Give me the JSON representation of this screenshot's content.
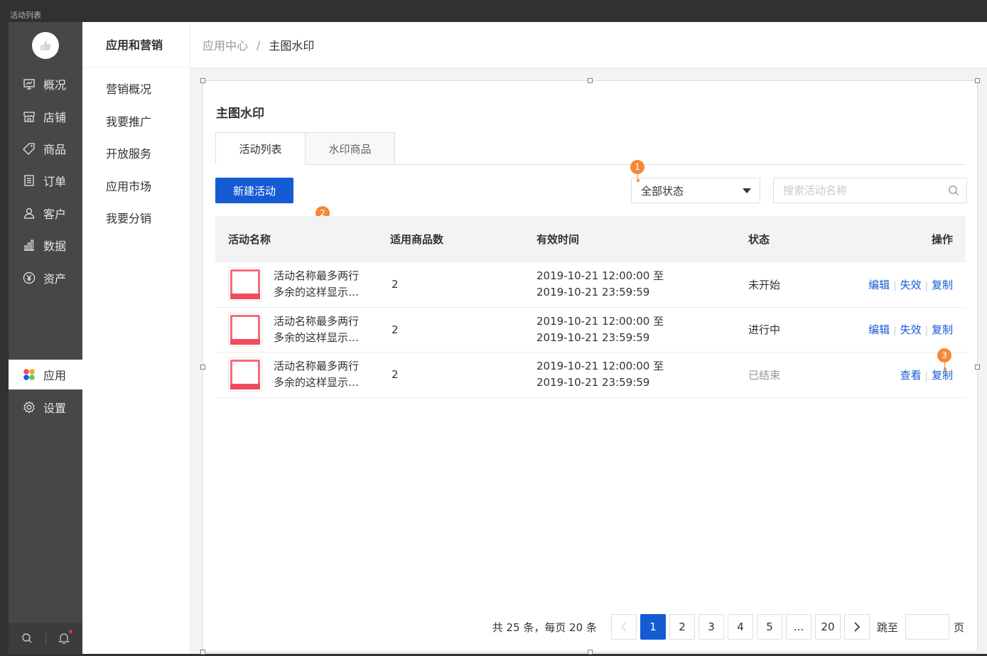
{
  "window": {
    "title": "活动列表"
  },
  "sidebar": {
    "items": [
      {
        "label": "概况",
        "icon": "presentation-icon"
      },
      {
        "label": "店铺",
        "icon": "store-icon"
      },
      {
        "label": "商品",
        "icon": "tag-icon"
      },
      {
        "label": "订单",
        "icon": "document-icon"
      },
      {
        "label": "客户",
        "icon": "user-icon"
      },
      {
        "label": "数据",
        "icon": "bar-chart-icon"
      },
      {
        "label": "资产",
        "icon": "yen-icon"
      },
      {
        "label": "应用",
        "icon": "apps-icon",
        "active": true
      },
      {
        "label": "设置",
        "icon": "gear-icon"
      }
    ],
    "footer": {
      "search_icon": "search-icon",
      "bell_icon": "bell-icon"
    }
  },
  "subnav": {
    "title": "应用和营销",
    "items": [
      "营销概况",
      "我要推广",
      "开放服务",
      "应用市场",
      "我要分销"
    ]
  },
  "breadcrumb": {
    "parent": "应用中心",
    "separator": "/",
    "current": "主图水印"
  },
  "page": {
    "title": "主图水印",
    "tabs": [
      "活动列表",
      "水印商品"
    ],
    "new_button": "新建活动",
    "status_select": "全部状态",
    "search_placeholder": "搜索活动名称",
    "annotations": [
      "1",
      "2",
      "3"
    ]
  },
  "table": {
    "columns": [
      "活动名称",
      "适用商品数",
      "有效时间",
      "状态",
      "操作"
    ],
    "rows": [
      {
        "name_line1": "活动名称最多两行",
        "name_line2": "多余的这样显示…",
        "count": "2",
        "time_start": "2019-10-21 12:00:00 至",
        "time_end": "2019-10-21 23:59:59",
        "status": "未开始",
        "actions": [
          "编辑",
          "失效",
          "复制"
        ]
      },
      {
        "name_line1": "活动名称最多两行",
        "name_line2": "多余的这样显示…",
        "count": "2",
        "time_start": "2019-10-21 12:00:00 至",
        "time_end": "2019-10-21 23:59:59",
        "status": "进行中",
        "actions": [
          "编辑",
          "失效",
          "复制"
        ]
      },
      {
        "name_line1": "活动名称最多两行",
        "name_line2": "多余的这样显示…",
        "count": "2",
        "time_start": "2019-10-21 12:00:00 至",
        "time_end": "2019-10-21 23:59:59",
        "status": "已结束",
        "actions": [
          "查看",
          "复制"
        ]
      }
    ]
  },
  "pagination": {
    "summary": "共 25 条，每页 20 条",
    "pages": [
      "1",
      "2",
      "3",
      "4",
      "5",
      "...",
      "20"
    ],
    "current": "1",
    "jump_label": "跳至",
    "jump_value": "",
    "page_suffix": "页"
  },
  "colors": {
    "primary": "#155bd4",
    "annotation": "#f5883a",
    "sidebar": "#464749"
  }
}
